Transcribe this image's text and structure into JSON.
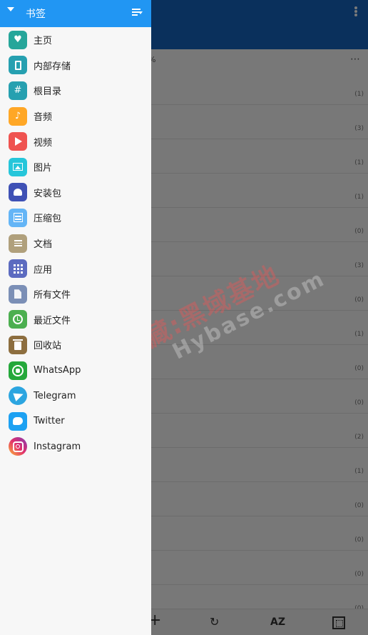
{
  "background_app": {
    "path_text": "%",
    "path_more": "⋯",
    "rows": [
      {
        "count": "(1)"
      },
      {
        "count": "(3)"
      },
      {
        "count": "(1)"
      },
      {
        "count": "(1)"
      },
      {
        "count": "(0)"
      },
      {
        "count": "(3)"
      },
      {
        "count": "(0)"
      },
      {
        "count": "(1)"
      },
      {
        "count": "(0)"
      },
      {
        "count": "(0)"
      },
      {
        "count": "(2)"
      },
      {
        "count": "(1)"
      },
      {
        "count": "(0)"
      },
      {
        "count": "(0)"
      },
      {
        "count": "(0)"
      },
      {
        "count": "(0)"
      }
    ],
    "bottom_bar": {
      "add": "+",
      "refresh": "↻",
      "sort": "AZ"
    },
    "watermark": {
      "line1": "记得收藏:黑域基地",
      "line2": "Hybase.com"
    }
  },
  "drawer": {
    "title": "书签",
    "items": [
      {
        "label": "主页",
        "icon": "heart-icon",
        "color": "#26a69a",
        "glyph": "♥"
      },
      {
        "label": "内部存储",
        "icon": "phone-storage-icon",
        "color": "#26a0b0",
        "glyph": ""
      },
      {
        "label": "根目录",
        "icon": "hash-icon",
        "color": "#26a0b0",
        "glyph": "#"
      },
      {
        "label": "音频",
        "icon": "music-icon",
        "color": "#ffa726",
        "glyph": "♪"
      },
      {
        "label": "视频",
        "icon": "play-icon",
        "color": "#ef5350",
        "glyph": ""
      },
      {
        "label": "图片",
        "icon": "image-icon",
        "color": "#26c6da",
        "glyph": ""
      },
      {
        "label": "安装包",
        "icon": "android-icon",
        "color": "#3f51b5",
        "glyph": ""
      },
      {
        "label": "压缩包",
        "icon": "archive-icon",
        "color": "#64b5f6",
        "glyph": ""
      },
      {
        "label": "文档",
        "icon": "document-icon",
        "color": "#b0a07c",
        "glyph": ""
      },
      {
        "label": "应用",
        "icon": "apps-grid-icon",
        "color": "#5c6bc0",
        "glyph": ""
      },
      {
        "label": "所有文件",
        "icon": "file-icon",
        "color": "#7b8fb6",
        "glyph": ""
      },
      {
        "label": "最近文件",
        "icon": "clock-icon",
        "color": "#4caf50",
        "glyph": ""
      },
      {
        "label": "回收站",
        "icon": "trash-icon",
        "color": "#8d6e3f",
        "glyph": ""
      },
      {
        "label": "WhatsApp",
        "icon": "whatsapp-icon",
        "color": "#25a83b",
        "glyph": ""
      },
      {
        "label": "Telegram",
        "icon": "telegram-icon",
        "color": "#2ca5e0",
        "glyph": ""
      },
      {
        "label": "Twitter",
        "icon": "twitter-icon",
        "color": "#1da1f2",
        "glyph": ""
      },
      {
        "label": "Instagram",
        "icon": "instagram-icon",
        "color": "#d6249f",
        "glyph": ""
      }
    ]
  }
}
